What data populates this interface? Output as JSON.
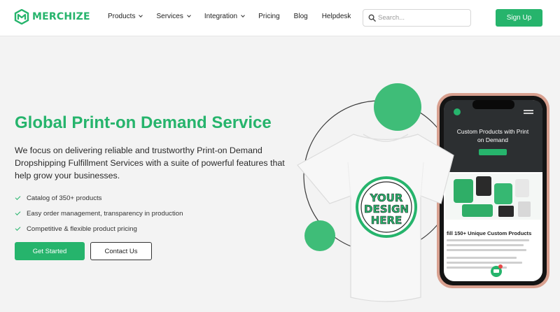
{
  "header": {
    "logo_text": "MERCHIZE",
    "nav": [
      {
        "label": "Products",
        "dropdown": true
      },
      {
        "label": "Services",
        "dropdown": true
      },
      {
        "label": "Integration",
        "dropdown": true
      },
      {
        "label": "Pricing",
        "dropdown": false
      },
      {
        "label": "Blog",
        "dropdown": false
      },
      {
        "label": "Helpdesk",
        "dropdown": false
      }
    ],
    "search_placeholder": "Search...",
    "signup_label": "Sign Up"
  },
  "hero": {
    "title": "Global Print-on Demand Service",
    "description": "We focus on delivering reliable and trustworthy Print-on Demand Dropshipping Fulfillment Services with a suite of powerful features that help grow your businesses.",
    "features": [
      "Catalog of 350+ products",
      "Easy order management, transparency in production",
      "Competitive & flexible product pricing"
    ],
    "cta_primary": "Get Started",
    "cta_secondary": "Contact Us"
  },
  "illustration": {
    "tshirt_print": [
      "YOUR",
      "DESIGN",
      "HERE"
    ],
    "phone_title_lines": [
      "Custom Products with Print",
      "on Demand"
    ],
    "phone_subheading": "fill 150+ Unique Custom Products"
  },
  "colors": {
    "brand_green": "#26b46c",
    "background": "#f3f3f3"
  }
}
